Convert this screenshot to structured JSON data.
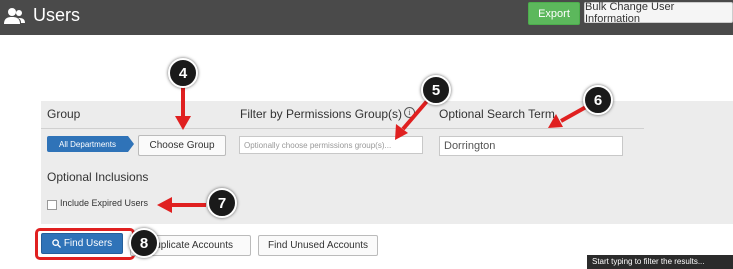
{
  "header": {
    "title": "Users",
    "export_label": "Export",
    "bulk_label": "Bulk Change User Information"
  },
  "filters": {
    "group_label": "Group",
    "all_departments_label": "All Departments",
    "choose_group_label": "Choose Group",
    "permissions_label": "Filter by Permissions Group(s)",
    "permissions_placeholder": "Optionally choose permissions group(s)...",
    "search_label": "Optional Search Term",
    "search_value": "Dorrington",
    "inclusions_label": "Optional Inclusions",
    "include_expired_label": "Include Expired Users"
  },
  "actions": {
    "find_users_label": "Find Users",
    "duplicate_label": "Duplicate Accounts",
    "unused_label": "Find Unused Accounts"
  },
  "tooltip": "Start typing to filter the results...",
  "callouts": [
    "4",
    "5",
    "6",
    "7",
    "8"
  ],
  "colors": {
    "topbar": "#4a4a4a",
    "export": "#5cb85c",
    "primary": "#2f73b8",
    "annotation_red": "#e02020"
  }
}
